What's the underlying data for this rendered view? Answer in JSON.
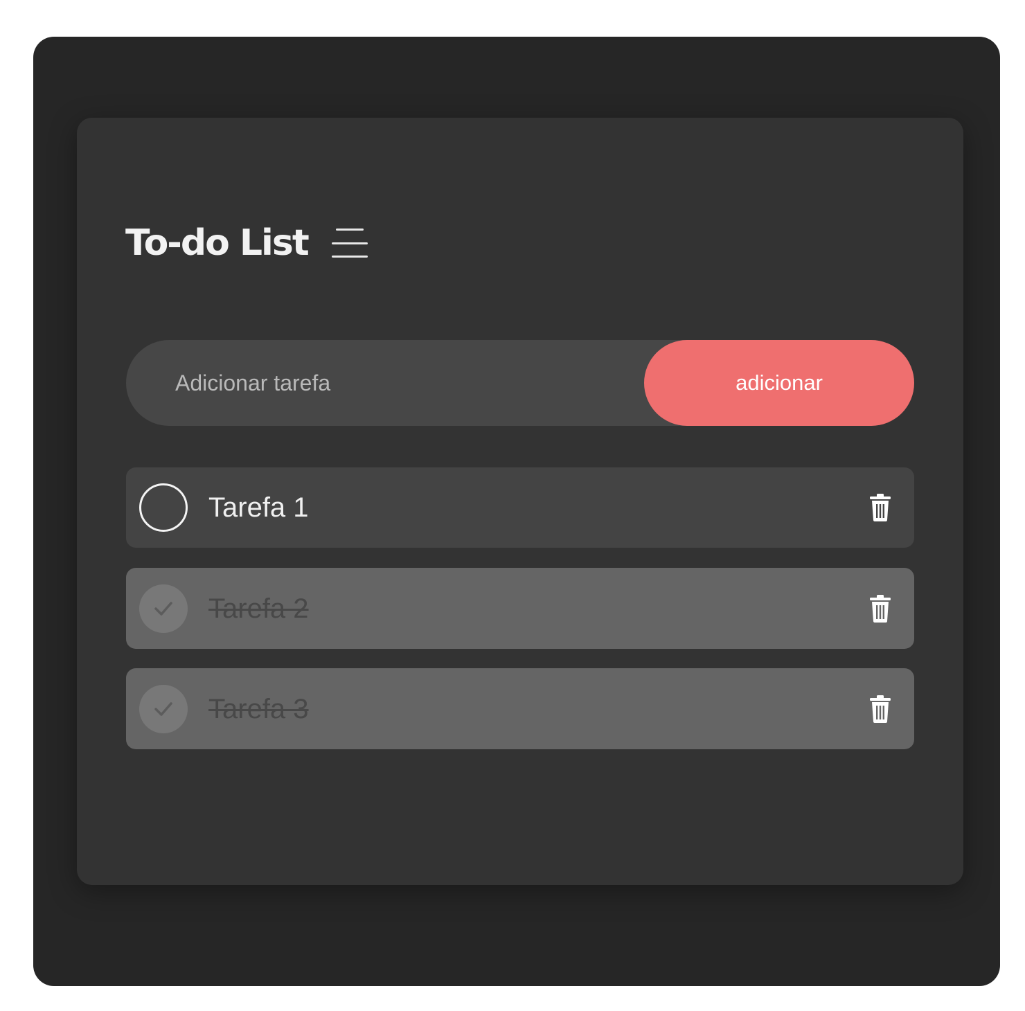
{
  "header": {
    "title": "To-do List",
    "menu_icon": "hamburger-menu-icon"
  },
  "add_task": {
    "placeholder": "Adicionar tarefa",
    "value": "",
    "button_label": "adicionar"
  },
  "tasks": [
    {
      "label": "Tarefa 1",
      "done": false,
      "check_icon": "circle-outline-icon",
      "delete_icon": "trash-icon"
    },
    {
      "label": "Tarefa 2",
      "done": true,
      "check_icon": "check-circle-icon",
      "delete_icon": "trash-icon"
    },
    {
      "label": "Tarefa 3",
      "done": true,
      "check_icon": "check-circle-icon",
      "delete_icon": "trash-icon"
    }
  ],
  "colors": {
    "page_background": "#ffffff",
    "frame_background": "#262626",
    "card_background": "#333333",
    "input_background": "#474747",
    "accent": "#ef6f6f",
    "task_background": "#444444",
    "task_done_background": "#656565"
  }
}
